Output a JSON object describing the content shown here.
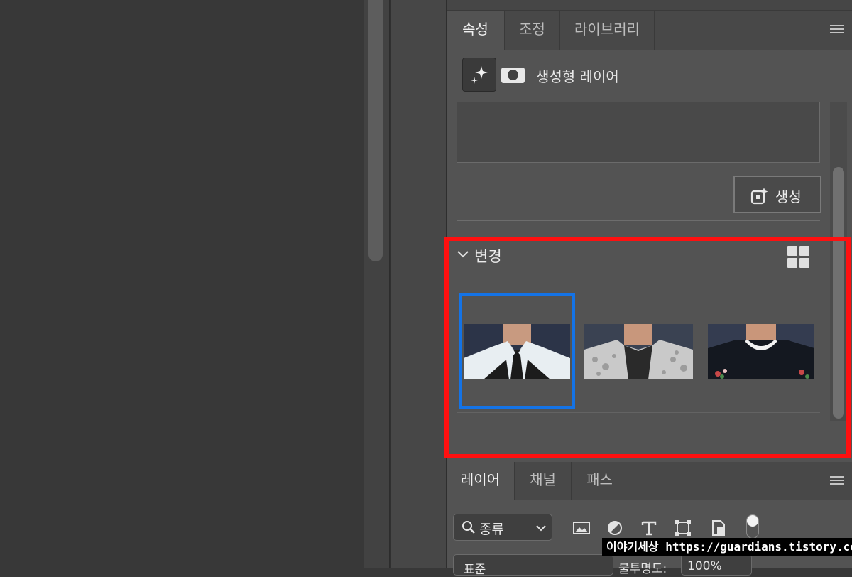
{
  "properties_panel": {
    "tabs": [
      {
        "label": "속성",
        "active": true
      },
      {
        "label": "조정",
        "active": false
      },
      {
        "label": "라이브러리",
        "active": false
      }
    ],
    "menu_icon": "hamburger-menu-icon",
    "generative_layer_title": "생성형 레이어",
    "prompt_value": "",
    "generate_button_label": "생성",
    "variations": {
      "title": "변경",
      "expanded": true,
      "selected_index": 0,
      "thumbnails": [
        {
          "name": "white-shirt-black-tie"
        },
        {
          "name": "lace-shirt"
        },
        {
          "name": "floral-sweatshirt"
        }
      ]
    },
    "highlight_color": "#ff1010",
    "selection_color": "#1473e6"
  },
  "layers_panel": {
    "tabs": [
      {
        "label": "레이어",
        "active": true
      },
      {
        "label": "채널",
        "active": false
      },
      {
        "label": "패스",
        "active": false
      }
    ],
    "filter_select_value": "종류",
    "filter_icons": [
      "image-icon",
      "adjustment-icon",
      "type-icon",
      "shape-icon",
      "smart-object-icon"
    ],
    "blend_mode_value": "표준",
    "opacity_label": "불투명도:",
    "opacity_value": "100%"
  },
  "watermark": {
    "text": "이야기세상 https://guardians.tistory.com"
  }
}
